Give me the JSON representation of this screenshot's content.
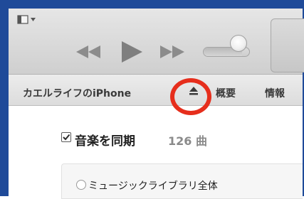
{
  "toolbar": {
    "icons": {
      "sidebar_toggle": "sidebar-toggle-icon",
      "rewind": "rewind-icon",
      "play": "play-icon",
      "fast_forward": "fast-forward-icon"
    },
    "volume": {
      "level": 0.85
    }
  },
  "device_bar": {
    "device_name": "カエルライフのiPhone",
    "eject_icon": "eject-icon",
    "tabs": [
      {
        "label": "概要"
      },
      {
        "label": "情報"
      }
    ]
  },
  "annotation": {
    "color": "#e62e1c",
    "shape": "circle"
  },
  "music_sync": {
    "checked": true,
    "label": "音楽を同期",
    "count": "126 曲"
  },
  "sync_option": {
    "selected": false,
    "label": "ミュージックライブラリ全体"
  },
  "colors": {
    "frame": "#1f4a99",
    "toolbar": "#d9d9d9",
    "annotation": "#e62e1c"
  }
}
